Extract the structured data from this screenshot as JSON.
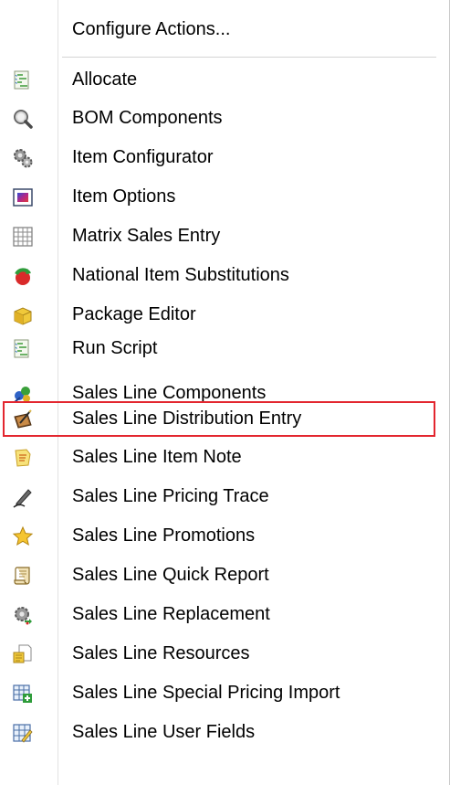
{
  "menu": {
    "configure_label": "Configure Actions...",
    "items": [
      {
        "label": "Allocate",
        "icon": "allocate-icon"
      },
      {
        "label": "BOM Components",
        "icon": "magnifier-icon"
      },
      {
        "label": "Item Configurator",
        "icon": "gears-icon"
      },
      {
        "label": "Item Options",
        "icon": "options-window-icon"
      },
      {
        "label": "Matrix Sales Entry",
        "icon": "grid-icon"
      },
      {
        "label": "National Item Substitutions",
        "icon": "swap-icon"
      },
      {
        "label": "Package Editor",
        "icon": "package-icon"
      },
      {
        "label": "Run Script",
        "icon": "script-icon"
      },
      {
        "label": "Sales Line Components",
        "icon": "components-icon"
      },
      {
        "label": "Sales Line Distribution Entry",
        "icon": "distribution-icon"
      },
      {
        "label": "Sales Line Item Note",
        "icon": "note-icon"
      },
      {
        "label": "Sales Line Pricing Trace",
        "icon": "pen-icon"
      },
      {
        "label": "Sales Line Promotions",
        "icon": "star-icon"
      },
      {
        "label": "Sales Line Quick Report",
        "icon": "scroll-icon"
      },
      {
        "label": "Sales Line Replacement",
        "icon": "replace-gear-icon"
      },
      {
        "label": "Sales Line Resources",
        "icon": "resources-icon"
      },
      {
        "label": "Sales Line Special Pricing Import",
        "icon": "grid-plus-icon"
      },
      {
        "label": "Sales Line User Fields",
        "icon": "grid-edit-icon"
      }
    ],
    "highlighted_item": "Sales Line Distribution Entry",
    "colors": {
      "highlight_border": "#e3262f",
      "separator": "#d4d4d4",
      "text": "#000000"
    }
  }
}
